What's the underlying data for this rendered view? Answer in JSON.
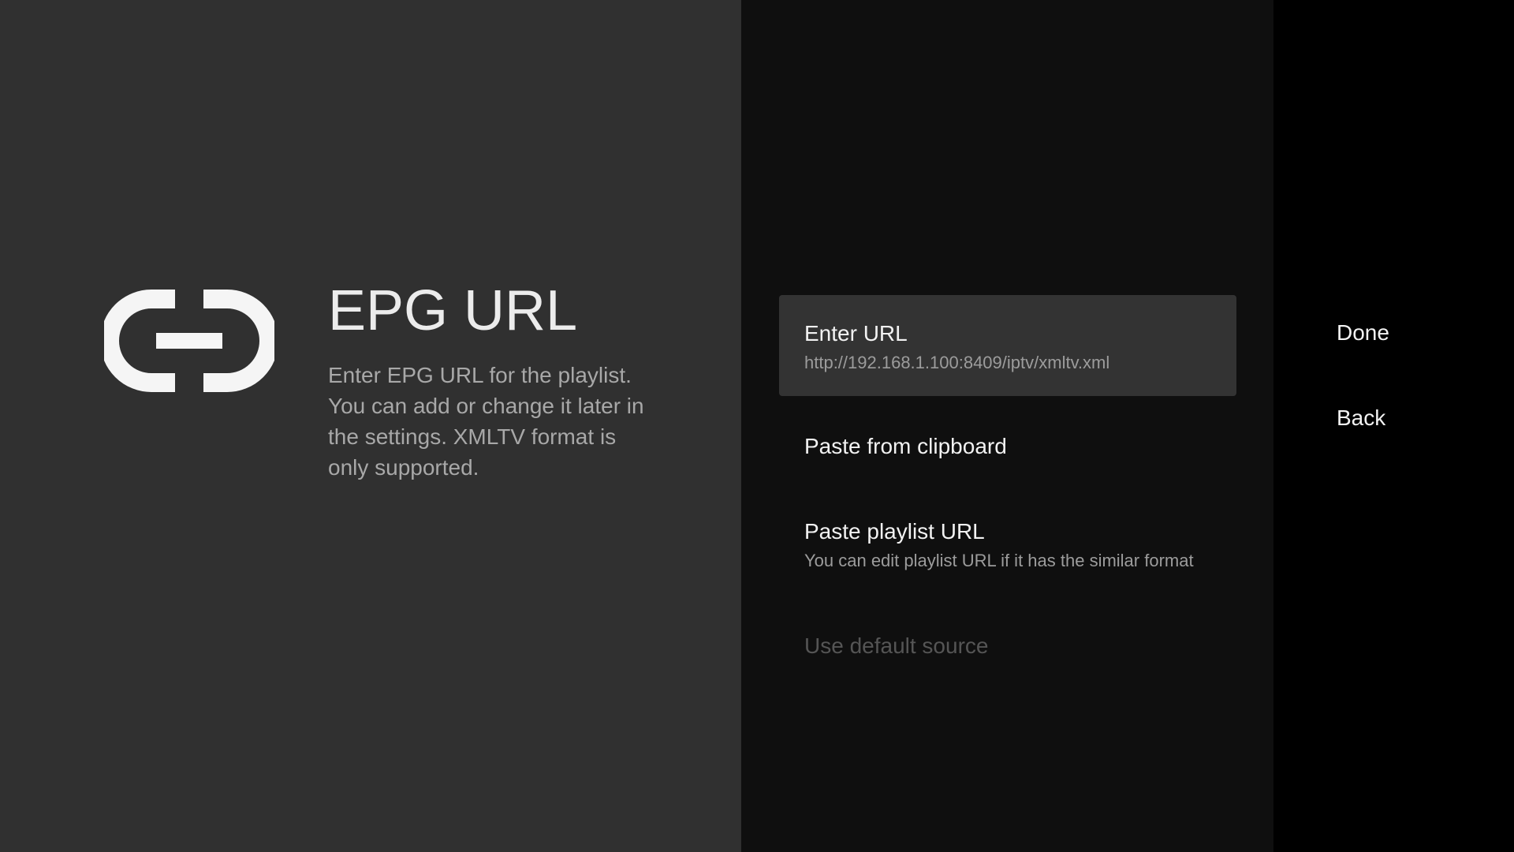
{
  "guidance": {
    "icon": "link-icon",
    "title": "EPG URL",
    "description": "Enter EPG URL for the playlist. You can add or change it later in the settings. XMLTV format is only supported."
  },
  "actions": [
    {
      "title": "Enter URL",
      "description": "http://192.168.1.100:8409/iptv/xmltv.xml",
      "state": "focused"
    },
    {
      "title": "Paste from clipboard",
      "description": "",
      "state": "normal"
    },
    {
      "title": "Paste playlist URL",
      "description": "You can edit playlist URL if it has the similar format",
      "state": "normal"
    },
    {
      "title": "Use default source",
      "description": "",
      "state": "disabled"
    }
  ],
  "buttons": [
    {
      "label": "Done"
    },
    {
      "label": "Back"
    }
  ],
  "colors": {
    "guidance_bg": "#303030",
    "actions_bg": "#0f0f0f",
    "buttons_bg": "#000000",
    "focused_item_bg": "#333333",
    "primary_text": "#f2f2f2",
    "secondary_text": "#9c9c9c",
    "disabled_text": "#555555"
  }
}
